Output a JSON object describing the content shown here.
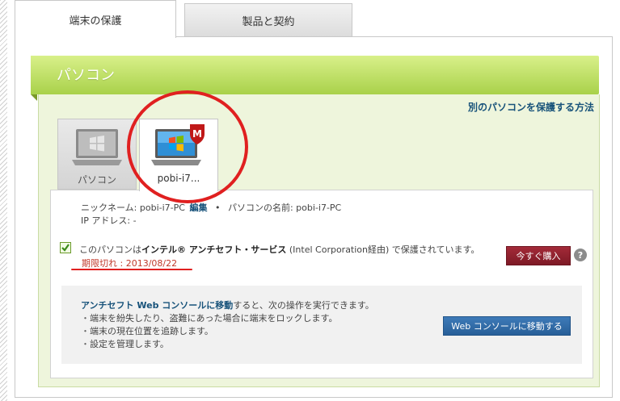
{
  "tabs": [
    {
      "label": "端末の保護",
      "active": true
    },
    {
      "label": "製品と契約",
      "active": false
    }
  ],
  "section": {
    "title": "パソコン"
  },
  "help_link": "別のパソコンを保護する方法",
  "devices": [
    {
      "label": "パソコン",
      "icon": "laptop-gray-icon"
    },
    {
      "label": "pobi-i7...",
      "icon": "laptop-windows-mcafee-icon"
    }
  ],
  "info": {
    "nickname_label": "ニックネーム:",
    "nickname_value": "pobi-i7-PC",
    "edit_link": "編集",
    "separator": "•",
    "pc_name_label": "パソコンの名前:",
    "pc_name_value": "pobi-i7-PC",
    "ip_label": "IP アドレス:",
    "ip_value": "-"
  },
  "protection": {
    "prefix": "このパソコンは",
    "product": "インテル® アンチセフト・サービス",
    "suffix": " (Intel Corporation経由) で保護されています。",
    "expiry": "期限切れ : 2013/08/22",
    "buy_button": "今すぐ購入",
    "help": "?"
  },
  "console": {
    "link_text": "アンチセフト Web コンソールに移動",
    "after_link": "すると、次の操作を実行できます。",
    "items": [
      "端末を紛失したり、盗難にあった場合に端末をロックします。",
      "端末の現在位置を追跡します。",
      "設定を管理します。"
    ],
    "button": "Web コンソールに移動する"
  },
  "colors": {
    "header_green": "#a9d14a",
    "link_blue": "#17527a",
    "buy_red": "#8e1f2d",
    "console_blue": "#2f6aa6",
    "annotation_red": "#e02020"
  }
}
